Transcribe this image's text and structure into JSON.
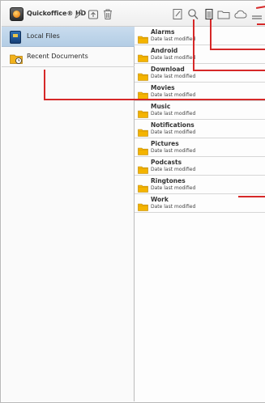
{
  "app": {
    "title": "Quickoffice® HD"
  },
  "toolbar": {
    "icons": [
      "edit-pencil-icon",
      "upload-icon",
      "trash-icon",
      "new-document-icon",
      "search-icon",
      "file-icon",
      "folder-icon",
      "cloud-add-icon",
      "menu-icon"
    ]
  },
  "sidebar": {
    "items": [
      {
        "label": "Local Files",
        "icon": "sd-card-icon",
        "selected": true
      },
      {
        "label": "Recent Documents",
        "icon": "recent-documents-icon",
        "selected": false
      }
    ]
  },
  "files": [
    {
      "name": "Alarms",
      "subtitle": "Date last modified"
    },
    {
      "name": "Android",
      "subtitle": "Date last modified"
    },
    {
      "name": "Download",
      "subtitle": "Date last modified"
    },
    {
      "name": "Movies",
      "subtitle": "Date last modified"
    },
    {
      "name": "Music",
      "subtitle": "Date last modified"
    },
    {
      "name": "Notifications",
      "subtitle": "Date last modified"
    },
    {
      "name": "Pictures",
      "subtitle": "Date last modified"
    },
    {
      "name": "Podcasts",
      "subtitle": "Date last modified"
    },
    {
      "name": "Ringtones",
      "subtitle": "Date last modified"
    },
    {
      "name": "Work",
      "subtitle": "Date last modified"
    }
  ],
  "colors": {
    "selection": "#b3cde5",
    "folder": "#f4b400",
    "callout": "#d62828"
  }
}
